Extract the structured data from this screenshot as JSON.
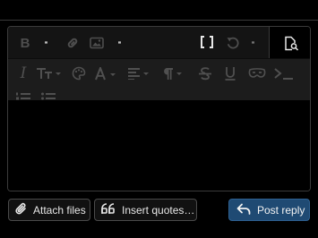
{
  "editor": {
    "toolbar": {
      "row1": [
        {
          "name": "bold-icon",
          "glyph": "B"
        },
        {
          "name": "more-text-options-icon"
        },
        {
          "name": "link-icon"
        },
        {
          "name": "image-icon"
        },
        {
          "name": "more-insert-options-icon"
        },
        {
          "name": "bbcode-toggle-icon",
          "glyph": "[ ]"
        },
        {
          "name": "undo-icon"
        },
        {
          "name": "more-options-icon"
        },
        {
          "name": "preview-icon"
        }
      ],
      "row2": [
        {
          "name": "italic-icon",
          "glyph": "I"
        },
        {
          "name": "font-size-icon"
        },
        {
          "name": "palette-icon"
        },
        {
          "name": "font-family-icon",
          "glyph": "A"
        },
        {
          "name": "align-icon"
        },
        {
          "name": "paragraph-icon",
          "glyph": "¶"
        },
        {
          "name": "strikethrough-icon",
          "glyph": "S"
        },
        {
          "name": "underline-icon",
          "glyph": "U"
        },
        {
          "name": "spoiler-icon"
        },
        {
          "name": "code-icon"
        }
      ],
      "row3": [
        {
          "name": "ordered-list-icon"
        },
        {
          "name": "unordered-list-icon"
        }
      ]
    },
    "content": ""
  },
  "actions": {
    "attach_label": "Attach files",
    "quote_label": "Insert quotes…",
    "post_label": "Post reply"
  },
  "colors": {
    "background": "#000000",
    "toolbar": "#1c1c1c",
    "primary_button": "#1f4a73",
    "border": "#3a3a3a"
  }
}
